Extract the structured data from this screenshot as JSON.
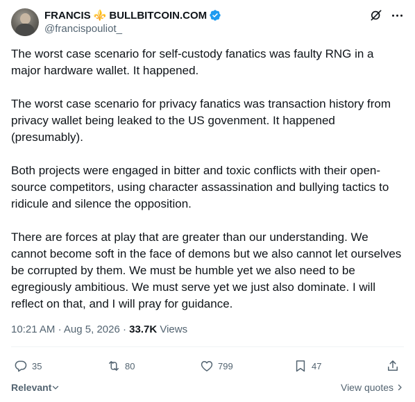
{
  "author": {
    "name_part1": "FRANCIS",
    "fleur_glyph": "⚜️",
    "name_part2": "BULLBITCOIN.COM",
    "handle": "@francispouliot_",
    "verified_color": "#1d9bf0"
  },
  "tweet": {
    "paragraphs": [
      "The worst case scenario for self-custody fanatics was faulty RNG in a major hardware wallet. It happened.",
      "The worst case scenario for privacy fanatics was transaction history from privacy wallet being leaked to the US govenment. It happened (presumably).",
      "Both projects were engaged in bitter and toxic conflicts with their open-source competitors, using character assassination and bullying tactics to ridicule and silence the opposition.",
      "There are forces at play that are greater than our understanding. We cannot become soft in the face of demons but we also cannot let ourselves be corrupted by them. We must be humble yet we also need to be egregiously ambitious. We must serve yet we just also dominate. I will reflect on that, and I will pray for guidance."
    ],
    "time": "10:21 AM",
    "date": "Aug 5, 2026",
    "views_count": "33.7K",
    "views_label": "Views"
  },
  "actions": {
    "replies": "35",
    "reposts": "80",
    "likes": "799",
    "bookmarks": "47"
  },
  "footer": {
    "relevant_label": "Relevant",
    "view_quotes_label": "View quotes"
  },
  "icons": [
    "grok-icon",
    "more-icon",
    "reply-icon",
    "repost-icon",
    "like-icon",
    "bookmark-icon",
    "share-icon",
    "chevron-down-icon",
    "chevron-right-icon",
    "verified-icon"
  ]
}
